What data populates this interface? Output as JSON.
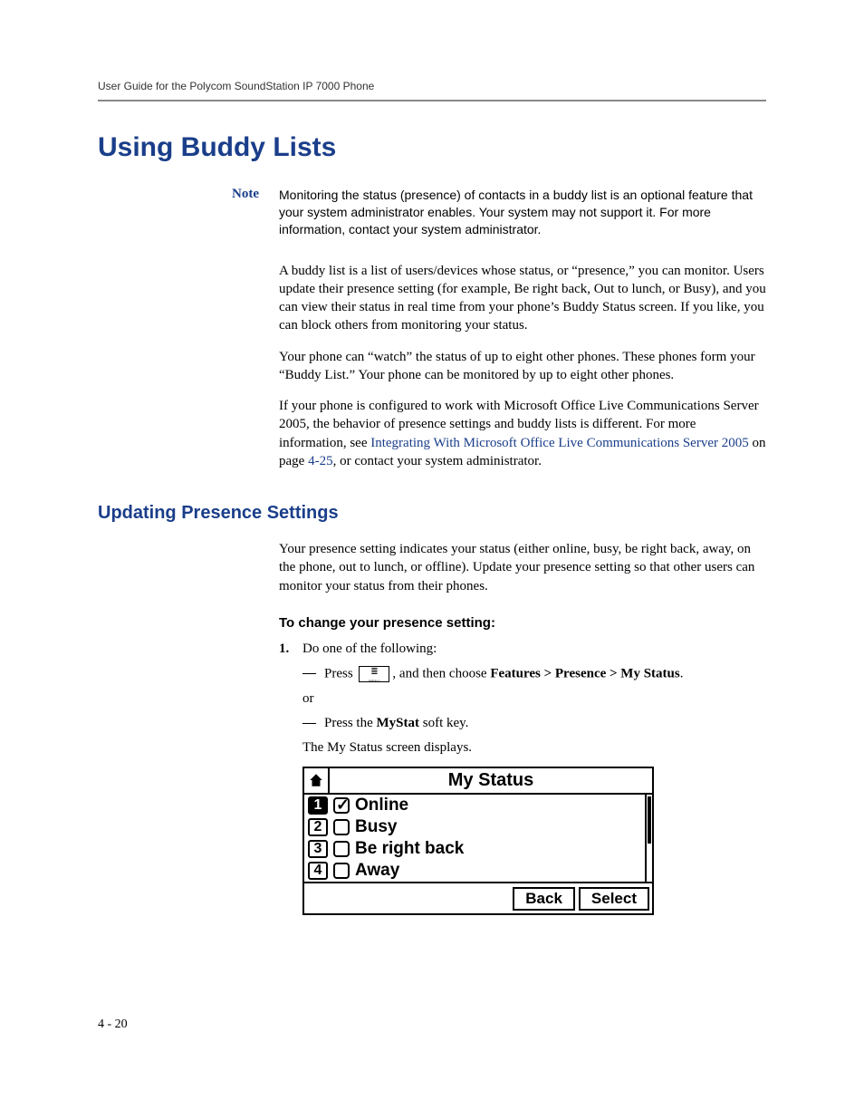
{
  "running_head": "User Guide for the Polycom SoundStation IP 7000 Phone",
  "h1": "Using Buddy Lists",
  "note_label": "Note",
  "note_body": "Monitoring the status (presence) of contacts in a buddy list is an optional feature that your system administrator enables. Your system may not support it. For more information, contact your system administrator.",
  "para1": "A buddy list is a list of users/devices whose status, or “presence,” you can monitor. Users update their presence setting (for example, Be right back, Out to lunch, or Busy), and you can view their status in real time from your phone’s Buddy Status screen. If you like, you can block others from monitoring your status.",
  "para2": "Your phone can “watch” the status of up to eight other phones. These phones form your “Buddy List.” Your phone can be monitored by up to eight other phones.",
  "para3_a": "If your phone is configured to work with Microsoft Office Live Communications Server 2005, the behavior of presence settings and buddy lists is different. For more information, see ",
  "para3_link": "Integrating With Microsoft Office Live Communications Server 2005",
  "para3_b": " on page ",
  "para3_pageref": "4-25",
  "para3_c": ", or contact your system administrator.",
  "h2": "Updating Presence Settings",
  "para4": "Your presence setting indicates your status (either online, busy, be right back, away, on the phone, out to lunch, or offline). Update your presence setting so that other users can monitor your status from their phones.",
  "proc_title": "To change your presence setting:",
  "step1_num": "1.",
  "step1_text": "Do one of the following:",
  "sub1_a": "Press ",
  "sub1_b": ", and then choose ",
  "sub1_nav": "Features > Presence > My Status",
  "sub1_c": ".",
  "or_text": "or",
  "sub2_a": "Press the ",
  "sub2_key": "MyStat",
  "sub2_b": " soft key.",
  "after_step": "The My Status screen displays.",
  "phone": {
    "title": "My Status",
    "items": [
      {
        "num": "1",
        "label": "Online",
        "checked": true
      },
      {
        "num": "2",
        "label": "Busy",
        "checked": false
      },
      {
        "num": "3",
        "label": "Be right back",
        "checked": false
      },
      {
        "num": "4",
        "label": "Away",
        "checked": false
      }
    ],
    "softkeys": {
      "back": "Back",
      "select": "Select"
    }
  },
  "page_number": "4 - 20"
}
